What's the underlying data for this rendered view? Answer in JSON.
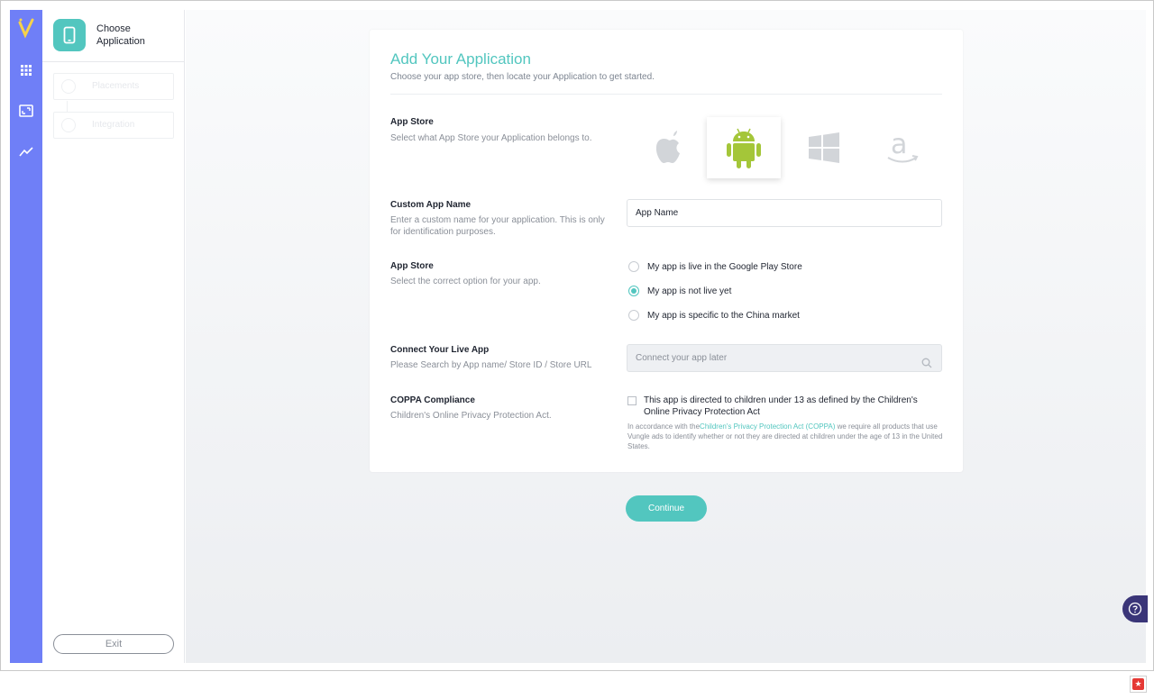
{
  "sidebar": {
    "active_step_label": "Choose Application",
    "steps": [
      {
        "label": "Placements"
      },
      {
        "label": "Integration"
      }
    ],
    "exit_label": "Exit"
  },
  "rail": {
    "icons": [
      "vungle-logo-icon",
      "grid-icon",
      "image-frame-icon",
      "trend-line-icon"
    ]
  },
  "form": {
    "title": "Add Your Application",
    "subtitle": "Choose your app store, then locate your Application to get started.",
    "app_store": {
      "label": "App Store",
      "description": "Select what App Store your Application belongs to.",
      "options": [
        "apple-icon",
        "android-icon",
        "windows-icon",
        "amazon-icon"
      ],
      "selected": "android-icon"
    },
    "custom_name": {
      "label": "Custom App Name",
      "description": "Enter a custom name for your application. This is only for identification purposes.",
      "value": "App Name"
    },
    "store_status": {
      "label": "App Store",
      "description": "Select the correct option for your app.",
      "options": [
        {
          "label": "My app is live in the Google Play Store",
          "selected": false
        },
        {
          "label": "My app is not live yet",
          "selected": true
        },
        {
          "label": "My app is specific to the China market",
          "selected": false
        }
      ]
    },
    "connect": {
      "label": "Connect Your Live App",
      "description": "Please Search by App name/ Store ID / Store URL",
      "placeholder": "Connect your app later"
    },
    "coppa": {
      "label": "COPPA Compliance",
      "description": "Children's Online Privacy Protection Act.",
      "checkbox_label": "This app is directed to children under 13 as defined by the Children's Online Privacy Protection Act",
      "fine_prefix": "In accordance with the",
      "fine_link": "Children's Privacy Protection Act (COPPA)",
      "fine_suffix": " we require all products that use Vungle ads to identify whether or not they are directed at children under the age of 13 in the United States."
    },
    "continue_label": "Continue"
  },
  "colors": {
    "accent": "#52c6bf",
    "rail": "#6f7ff7",
    "android": "#a4c639",
    "help": "#3a3578"
  }
}
